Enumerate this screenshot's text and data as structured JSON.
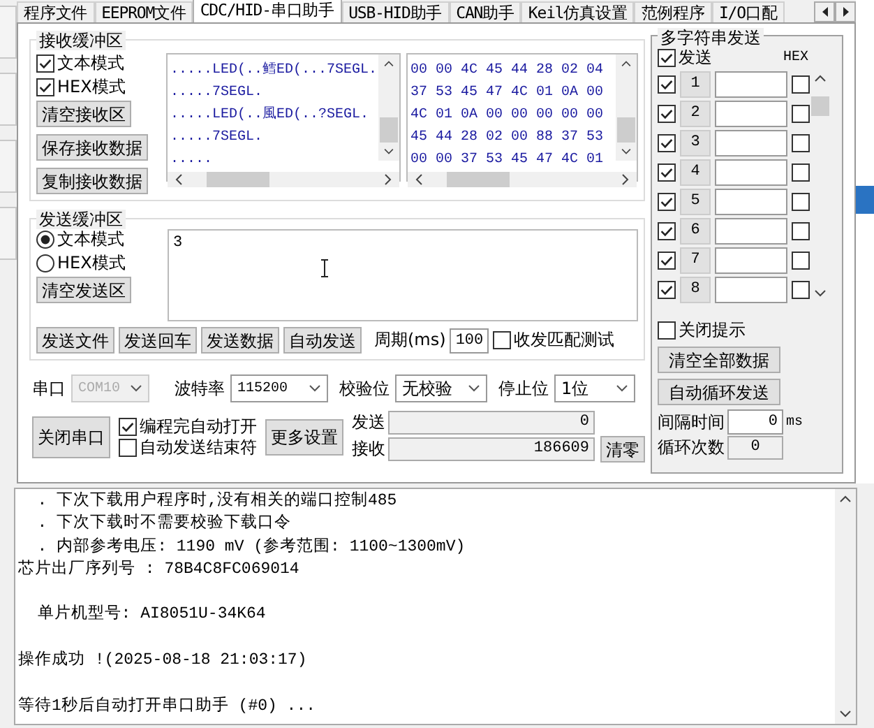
{
  "tabs": [
    {
      "label": "程序文件",
      "selected": false
    },
    {
      "label": "EEPROM文件",
      "selected": false
    },
    {
      "label": "CDC/HID-串口助手",
      "selected": true
    },
    {
      "label": "USB-HID助手",
      "selected": false
    },
    {
      "label": "CAN助手",
      "selected": false
    },
    {
      "label": "Keil仿真设置",
      "selected": false
    },
    {
      "label": "范例程序",
      "selected": false
    },
    {
      "label": "I/O口配",
      "selected": false
    }
  ],
  "receive_buffer": {
    "title": "接收缓冲区",
    "modes": [
      {
        "label": "文本模式",
        "checked": true
      },
      {
        "label": "HEX模式",
        "checked": true
      }
    ],
    "buttons": [
      "清空接收区",
      "保存接收数据",
      "复制接收数据"
    ],
    "text_lines": [
      ".....LED(..鳕ED(...7SEGL.",
      ".....7SEGL.",
      ".....LED(..風ED(..?SEGL.",
      ".....7SEGL.",
      "....."
    ],
    "hex_lines": [
      "00 00 4C 45 44 28 02 04",
      "37 53 45 47 4C 01 0A 00",
      "4C 01 0A 00 00 00 00 00",
      "45 44 28 02 00 88 37 53",
      "00 00 37 53 45 47 4C 01"
    ]
  },
  "send_buffer": {
    "title": "发送缓冲区",
    "modes": [
      {
        "label": "文本模式",
        "selected": true
      },
      {
        "label": "HEX模式",
        "selected": false
      }
    ],
    "clear_button": "清空发送区",
    "value": "3",
    "buttons": [
      "发送文件",
      "发送回车",
      "发送数据",
      "自动发送"
    ],
    "period_label": "周期(ms)",
    "period": "100",
    "match_test": {
      "label": "收发匹配测试",
      "checked": false
    }
  },
  "serial": {
    "port_label": "串口",
    "port": "COM10",
    "port_disabled": true,
    "baud_label": "波特率",
    "baud": "115200",
    "parity_label": "校验位",
    "parity": "无校验",
    "stop_label": "停止位",
    "stop": "1位"
  },
  "controls": {
    "close_button": "关闭串口",
    "options": [
      {
        "label": "编程完自动打开",
        "checked": true
      },
      {
        "label": "自动发送结束符",
        "checked": false
      }
    ],
    "more_button": "更多设置",
    "send_label": "发送",
    "send_count": "0",
    "receive_label": "接收",
    "receive_count": "186609",
    "reset_button": "清零"
  },
  "multi_send": {
    "title": "多字符串发送",
    "send_all": {
      "label": "发送",
      "checked": true
    },
    "hex_header": "HEX",
    "rows": [
      {
        "index": "1",
        "checked": true,
        "hex": false
      },
      {
        "index": "2",
        "checked": true,
        "hex": false
      },
      {
        "index": "3",
        "checked": true,
        "hex": false
      },
      {
        "index": "4",
        "checked": true,
        "hex": false
      },
      {
        "index": "5",
        "checked": true,
        "hex": false
      },
      {
        "index": "6",
        "checked": true,
        "hex": false
      },
      {
        "index": "7",
        "checked": true,
        "hex": false
      },
      {
        "index": "8",
        "checked": true,
        "hex": false
      }
    ],
    "close_tips": {
      "label": "关闭提示",
      "checked": false
    },
    "buttons": [
      "清空全部数据",
      "自动循环发送"
    ],
    "interval_label": "间隔时间",
    "interval": "0",
    "interval_unit": "ms",
    "loop_label": "循环次数",
    "loop": "0"
  },
  "log": {
    "lines": [
      {
        "text": "  . 下次下载用户程序时,没有相关的端口控制485",
        "gap_before": false
      },
      {
        "text": "  . 下次下载时不需要校验下载口令",
        "gap_before": false
      },
      {
        "text": "  . 内部参考电压: 1190 mV (参考范围: 1100~1300mV)",
        "gap_before": false
      },
      {
        "text": "芯片出厂序列号 : 78B4C8FC069014",
        "gap_before": false
      },
      {
        "text": "  单片机型号: AI8051U-34K64",
        "gap_before": true
      },
      {
        "text": "操作成功 !(2025-08-18 21:03:17)",
        "gap_before": true
      },
      {
        "text": "等待1秒后自动打开串口助手 (#0) ...",
        "gap_before": true
      }
    ]
  }
}
